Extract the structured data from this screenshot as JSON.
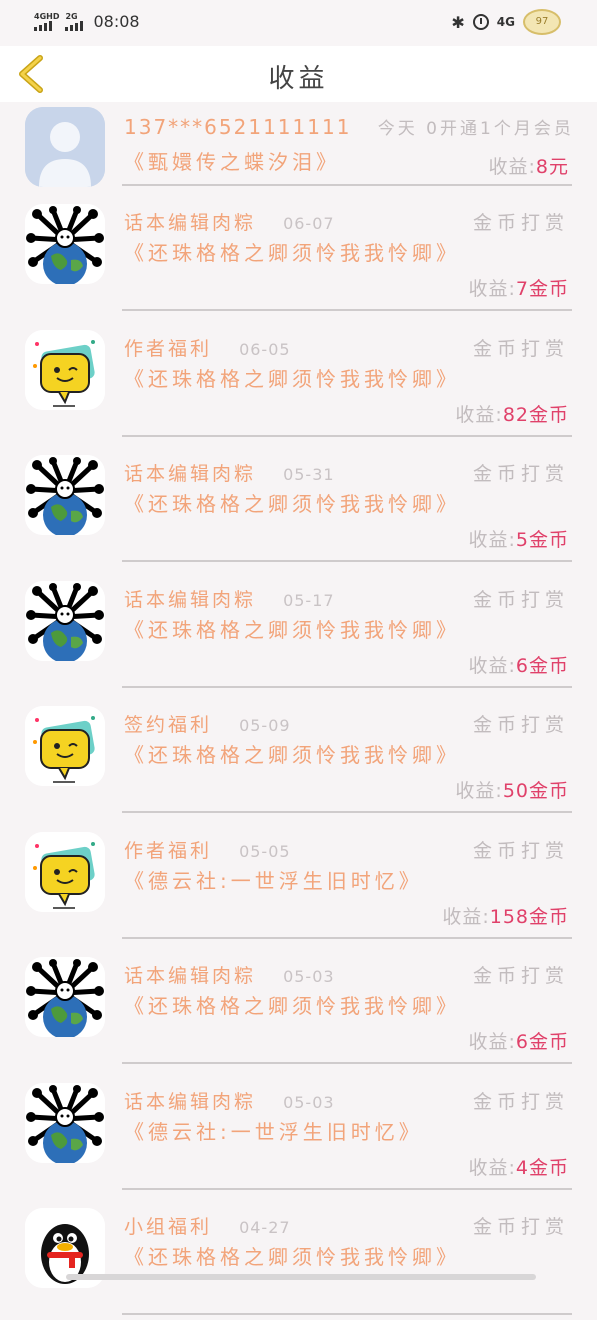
{
  "status_bar": {
    "signal1_label": "4GHD",
    "signal2_label": "2G",
    "time": "08:08",
    "network": "4G",
    "battery_text": "97"
  },
  "header": {
    "title": "收益"
  },
  "first_item": {
    "phone": "137***6521111111",
    "info": "今天 0开通1个月会员",
    "book": "《甄嬛传之蝶汐泪》",
    "earn_label": "收益:",
    "earn_amount": "8元"
  },
  "items": [
    {
      "source": "话本编辑肉粽",
      "date": "06-07",
      "type": "金币打赏",
      "book": "《还珠格格之卿须怜我我怜卿》",
      "earn_label": "收益:",
      "earn_amount": "7金币",
      "avatar": "earth-avatar"
    },
    {
      "source": "作者福利",
      "date": "06-05",
      "type": "金币打赏",
      "book": "《还珠格格之卿须怜我我怜卿》",
      "earn_label": "收益:",
      "earn_amount": "82金币",
      "avatar": "chat-avatar"
    },
    {
      "source": "话本编辑肉粽",
      "date": "05-31",
      "type": "金币打赏",
      "book": "《还珠格格之卿须怜我我怜卿》",
      "earn_label": "收益:",
      "earn_amount": "5金币",
      "avatar": "earth-avatar"
    },
    {
      "source": "话本编辑肉粽",
      "date": "05-17",
      "type": "金币打赏",
      "book": "《还珠格格之卿须怜我我怜卿》",
      "earn_label": "收益:",
      "earn_amount": "6金币",
      "avatar": "earth-avatar"
    },
    {
      "source": "签约福利",
      "date": "05-09",
      "type": "金币打赏",
      "book": "《还珠格格之卿须怜我我怜卿》",
      "earn_label": "收益:",
      "earn_amount": "50金币",
      "avatar": "chat-avatar"
    },
    {
      "source": "作者福利",
      "date": "05-05",
      "type": "金币打赏",
      "book": "《德云社:一世浮生旧时忆》",
      "earn_label": "收益:",
      "earn_amount": "158金币",
      "avatar": "chat-avatar"
    },
    {
      "source": "话本编辑肉粽",
      "date": "05-03",
      "type": "金币打赏",
      "book": "《还珠格格之卿须怜我我怜卿》",
      "earn_label": "收益:",
      "earn_amount": "6金币",
      "avatar": "earth-avatar"
    },
    {
      "source": "话本编辑肉粽",
      "date": "05-03",
      "type": "金币打赏",
      "book": "《德云社:一世浮生旧时忆》",
      "earn_label": "收益:",
      "earn_amount": "4金币",
      "avatar": "earth-avatar"
    },
    {
      "source": "小组福利",
      "date": "04-27",
      "type": "金币打赏",
      "book": "《还珠格格之卿须怜我我怜卿》",
      "earn_label": "",
      "earn_amount": "",
      "avatar": "penguin-avatar"
    }
  ]
}
